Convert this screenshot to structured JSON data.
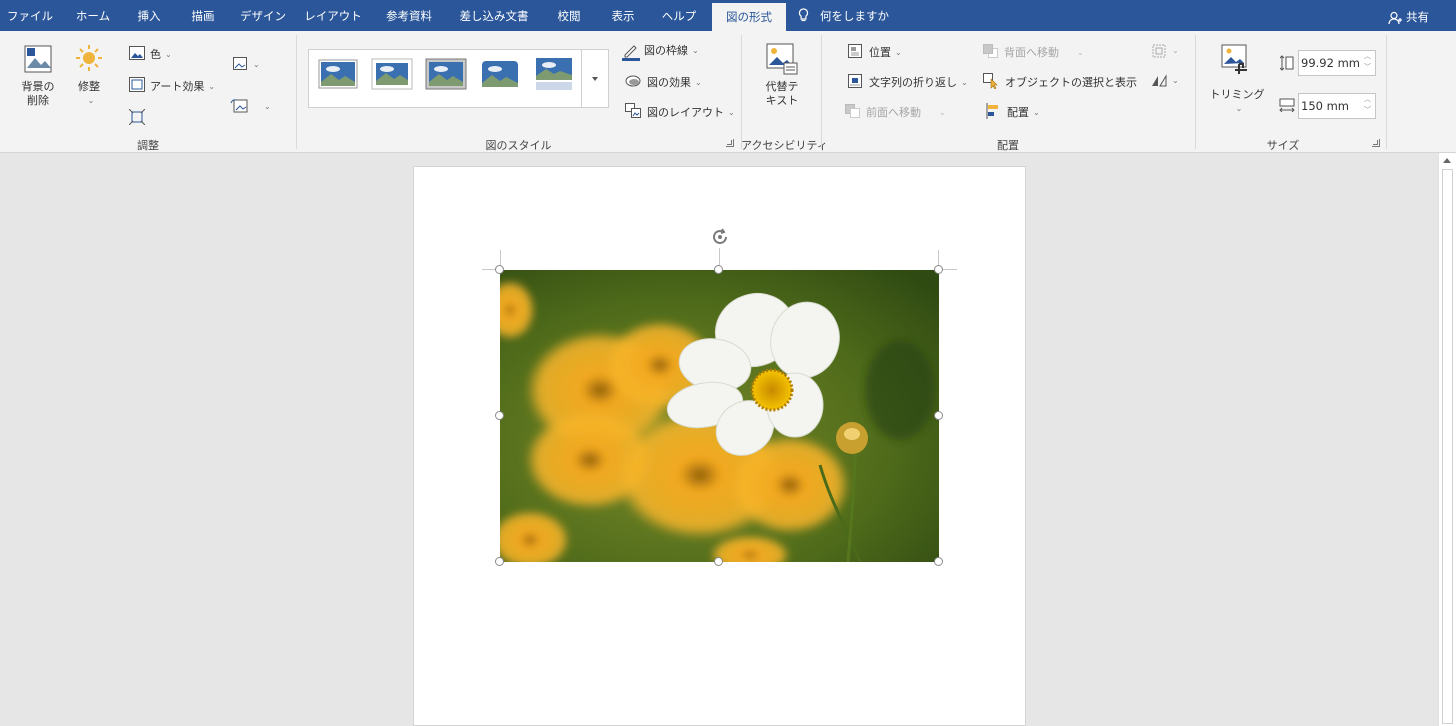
{
  "tabs": [
    {
      "label": "ファイル",
      "active": false
    },
    {
      "label": "ホーム",
      "active": false
    },
    {
      "label": "挿入",
      "active": false
    },
    {
      "label": "描画",
      "active": false
    },
    {
      "label": "デザイン",
      "active": false
    },
    {
      "label": "レイアウト",
      "active": false
    },
    {
      "label": "参考資料",
      "active": false
    },
    {
      "label": "差し込み文書",
      "active": false
    },
    {
      "label": "校閲",
      "active": false
    },
    {
      "label": "表示",
      "active": false
    },
    {
      "label": "ヘルプ",
      "active": false
    },
    {
      "label": "図の形式",
      "active": true
    }
  ],
  "tell_me": "何をしますか",
  "share": "共有",
  "groups": {
    "adjust": {
      "label": "調整",
      "remove_bg": "背景の\n削除",
      "corrections": "修整",
      "color": "色",
      "artistic": "アート効果"
    },
    "styles": {
      "label": "図のスタイル",
      "border": "図の枠線",
      "effects": "図の効果",
      "layout": "図のレイアウト"
    },
    "accessibility": {
      "label": "アクセシビリティ",
      "alt_text": "代替テ\nキスト"
    },
    "arrange": {
      "label": "配置",
      "position": "位置",
      "wrap": "文字列の折り返し",
      "forward": "前面へ移動",
      "backward": "背面へ移動",
      "selection_pane": "オブジェクトの選択と表示",
      "align": "配置"
    },
    "size": {
      "label": "サイズ",
      "crop": "トリミング",
      "height": "99.92 mm",
      "width": "150 mm"
    }
  },
  "colors": {
    "accent": "#2b579a",
    "ribbon": "#f3f3f3",
    "canvas": "#e6e6e6"
  }
}
